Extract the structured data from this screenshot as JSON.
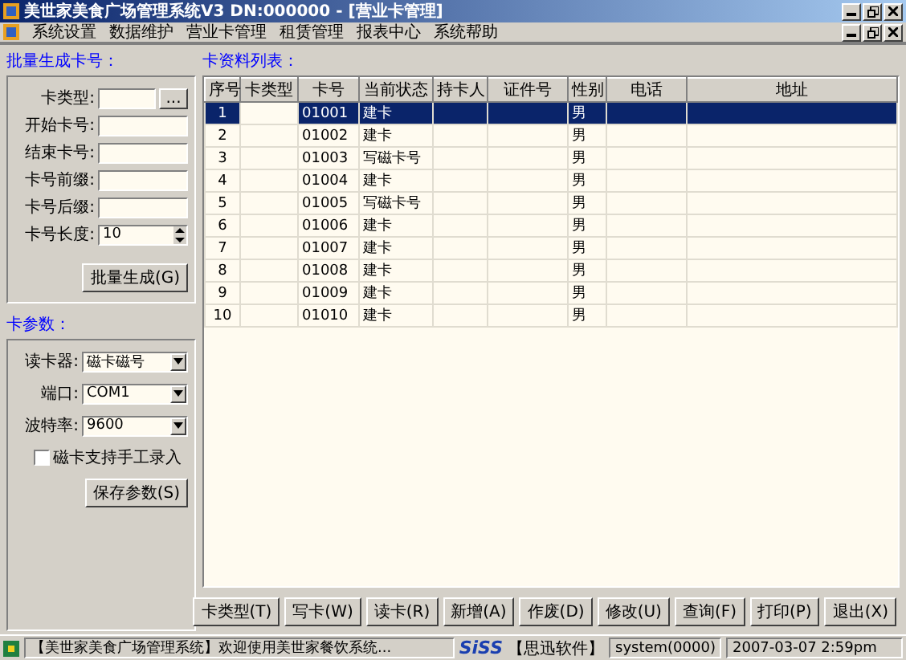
{
  "window": {
    "title": "美世家美食广场管理系统V3 DN:000000 - [营业卡管理]"
  },
  "menu": [
    "系统设置",
    "数据维护",
    "营业卡管理",
    "租赁管理",
    "报表中心",
    "系统帮助"
  ],
  "batch_section": {
    "title": "批量生成卡号：",
    "fields": [
      {
        "label": "卡类型:",
        "kind": "picker",
        "picker_label": "..."
      },
      {
        "label": "开始卡号:",
        "kind": "text"
      },
      {
        "label": "结束卡号:",
        "kind": "text"
      },
      {
        "label": "卡号前缀:",
        "kind": "text"
      },
      {
        "label": "卡号后缀:",
        "kind": "text"
      },
      {
        "label": "卡号长度:",
        "value": "10",
        "kind": "spinner"
      }
    ],
    "button": "批量生成(G)"
  },
  "card_params": {
    "title": "卡参数：",
    "fields": [
      {
        "label": "读卡器:",
        "value": "磁卡磁号"
      },
      {
        "label": "端口:",
        "value": "COM1"
      },
      {
        "label": "波特率:",
        "value": "9600"
      }
    ],
    "checkbox": {
      "label": "磁卡支持手工录入",
      "checked": false
    },
    "button": "保存参数(S)"
  },
  "table": {
    "title": "卡资料列表：",
    "columns": [
      "序号",
      "卡类型",
      "卡号",
      "当前状态",
      "持卡人",
      "证件号",
      "性别",
      "电话",
      "地址"
    ],
    "rows": [
      {
        "cells": [
          "1",
          "",
          "01001",
          "建卡",
          "",
          "",
          "男",
          "",
          ""
        ],
        "selected": true
      },
      {
        "cells": [
          "2",
          "",
          "01002",
          "建卡",
          "",
          "",
          "男",
          "",
          ""
        ],
        "selected": false
      },
      {
        "cells": [
          "3",
          "",
          "01003",
          "写磁卡号",
          "",
          "",
          "男",
          "",
          ""
        ],
        "selected": false
      },
      {
        "cells": [
          "4",
          "",
          "01004",
          "建卡",
          "",
          "",
          "男",
          "",
          ""
        ],
        "selected": false
      },
      {
        "cells": [
          "5",
          "",
          "01005",
          "写磁卡号",
          "",
          "",
          "男",
          "",
          ""
        ],
        "selected": false
      },
      {
        "cells": [
          "6",
          "",
          "01006",
          "建卡",
          "",
          "",
          "男",
          "",
          ""
        ],
        "selected": false
      },
      {
        "cells": [
          "7",
          "",
          "01007",
          "建卡",
          "",
          "",
          "男",
          "",
          ""
        ],
        "selected": false
      },
      {
        "cells": [
          "8",
          "",
          "01008",
          "建卡",
          "",
          "",
          "男",
          "",
          ""
        ],
        "selected": false
      },
      {
        "cells": [
          "9",
          "",
          "01009",
          "建卡",
          "",
          "",
          "男",
          "",
          ""
        ],
        "selected": false
      },
      {
        "cells": [
          "10",
          "",
          "01010",
          "建卡",
          "",
          "",
          "男",
          "",
          ""
        ],
        "selected": false
      }
    ]
  },
  "buttons": [
    "卡类型(T)",
    "写卡(W)",
    "读卡(R)",
    "新增(A)",
    "作废(D)",
    "修改(U)",
    "查询(F)",
    "打印(P)",
    "退出(X)"
  ],
  "status_bar": {
    "message": "【美世家美食广场管理系统】欢迎使用美世家餐饮系统...",
    "brand": "SiSS",
    "company": "【思迅软件】",
    "user": "system(0000)",
    "datetime": "2007-03-07 2:59pm"
  }
}
